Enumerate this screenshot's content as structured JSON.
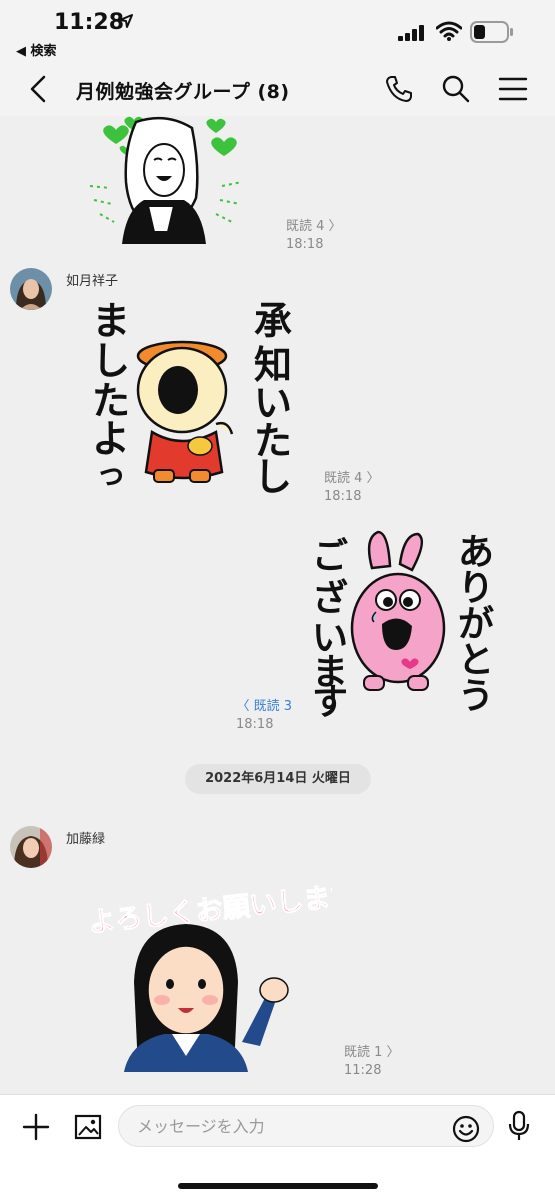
{
  "status_bar": {
    "time": "11:28",
    "back_app": "◀ 検索"
  },
  "header": {
    "title": "月例勉強会グループ (8)"
  },
  "messages": [
    {
      "read": "既読 4 〉",
      "time": "18:18"
    },
    {
      "sender": "如月祥子",
      "read": "既読 4 〉",
      "time": "18:18",
      "sticker_text": "承知いたしましたよっ"
    },
    {
      "read": "〈 既読 3",
      "time": "18:18",
      "sticker_text": "ありがとうございますっ"
    },
    {
      "sender": "加藤緑",
      "read": "既読 1 〉",
      "time": "11:28",
      "sticker_text": "よろしくお願いします"
    }
  ],
  "date_separator": "2022年6月14日 火曜日",
  "composer": {
    "placeholder": "メッセージを入力"
  },
  "colors": {
    "read_mine": "#3c80d6",
    "background": "#efefef",
    "heart_green": "#3cc23c"
  }
}
